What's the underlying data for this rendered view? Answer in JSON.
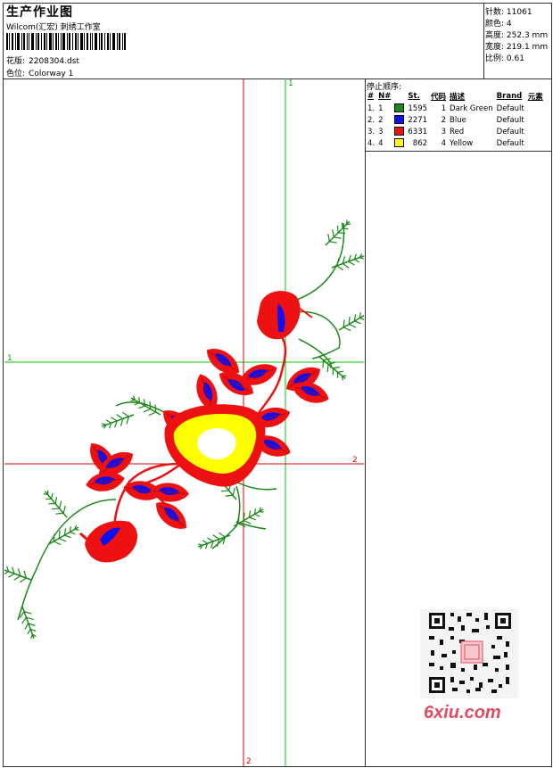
{
  "header": {
    "title": "生产作业图",
    "company": "Wilcom(汇宏) 刺绣工作室",
    "design_label": "花版:",
    "design_value": "2208304.dst",
    "colorway_label": "色位:",
    "colorway_value": "Colorway 1"
  },
  "stats": {
    "stitches": {
      "label": "针数:",
      "value": "11061"
    },
    "colors": {
      "label": "颜色:",
      "value": "4"
    },
    "height": {
      "label": "高度:",
      "value": "252.3 mm"
    },
    "width": {
      "label": "宽度:",
      "value": "219.1 mm"
    },
    "scale": {
      "label": "比例:",
      "value": "0.61"
    }
  },
  "stop_sequence": {
    "title": "停止顺序:",
    "columns": [
      "#",
      "N#",
      "St.",
      "代码",
      "描述",
      "Brand",
      "元素"
    ],
    "rows": [
      {
        "idx": "1.",
        "n": "1",
        "color": "#1a8a1a",
        "st": "1595",
        "code": "1",
        "desc": "Dark Green",
        "brand": "Default"
      },
      {
        "idx": "2.",
        "n": "2",
        "color": "#1010ee",
        "st": "2271",
        "code": "2",
        "desc": "Blue",
        "brand": "Default"
      },
      {
        "idx": "3.",
        "n": "3",
        "color": "#ee1111",
        "st": "6331",
        "code": "3",
        "desc": "Red",
        "brand": "Default"
      },
      {
        "idx": "4.",
        "n": "4",
        "color": "#ffff00",
        "st": "862",
        "code": "4",
        "desc": "Yellow",
        "brand": "Default"
      }
    ]
  },
  "guides": {
    "green_label_top": "1",
    "green_label_left": "1",
    "red_label_right": "2",
    "red_label_bottom": "2"
  },
  "watermark": "6xiu.com",
  "palette": {
    "green": "#1a8a1a",
    "blue": "#1010ee",
    "red": "#ee1111",
    "yellow": "#ffff00",
    "guide_green": "#00cc00",
    "guide_red": "#dd0000"
  }
}
